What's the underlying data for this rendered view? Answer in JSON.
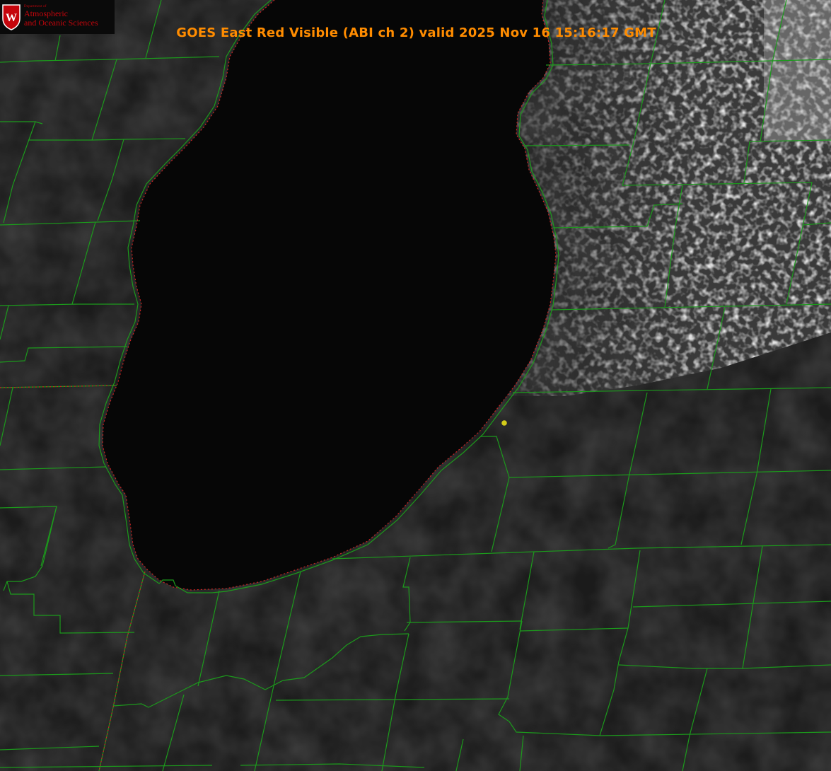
{
  "title": "GOES East Red Visible (ABI ch 2) valid 2025 Nov 16 15:16:17 GMT",
  "logo": {
    "dept": "Department of",
    "line1": "Atmospheric",
    "line2": "and Oceanic Sciences",
    "shield_letter": "W"
  },
  "colors": {
    "title": "#ff8c00",
    "county_lines": "#1c9a1c",
    "state_line": "#cc2222",
    "lake": "#060606",
    "land": "#1a1a1a",
    "clouds": "#8a8a8a",
    "marker": "#d4cc1a",
    "logo_red": "#c5050c"
  },
  "marker": {
    "label": "yellow point marker",
    "icon": "dot"
  }
}
